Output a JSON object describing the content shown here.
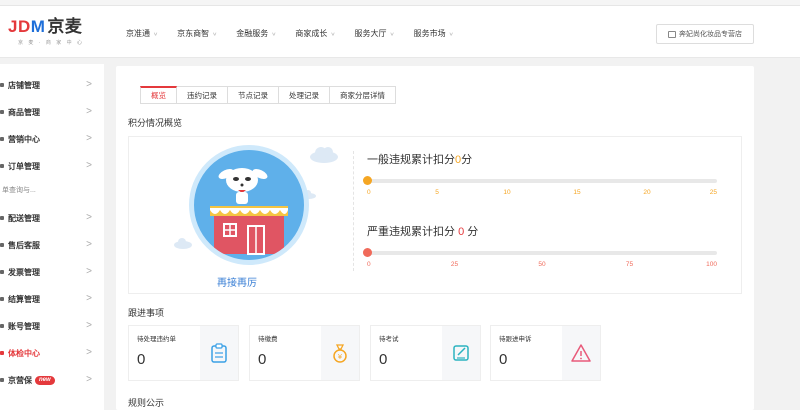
{
  "header": {
    "logo_text": "JDM",
    "logo_cn": "京麦",
    "logo_sub": "京 麦 · 商 家 中 心",
    "nav": [
      "京准通",
      "京东商智",
      "金融服务",
      "商家成长",
      "服务大厅",
      "服务市场"
    ],
    "store_button": "奔妃尚化妆品专营店"
  },
  "sidebar": {
    "items": [
      {
        "label": "店铺管理"
      },
      {
        "label": "商品管理"
      },
      {
        "label": "营销中心"
      },
      {
        "label": "订单管理"
      },
      {
        "label": "配送管理"
      },
      {
        "label": "售后客服"
      },
      {
        "label": "发票管理"
      },
      {
        "label": "结算管理"
      },
      {
        "label": "账号管理"
      },
      {
        "label": "体检中心"
      },
      {
        "label": "京营保"
      }
    ],
    "sub_text": "单查询与...",
    "new_badge": "new"
  },
  "main": {
    "tabs": [
      "概览",
      "违约记录",
      "节点记录",
      "处理记录",
      "商家分层详情"
    ],
    "active_tab": 0,
    "section_score": "积分情况概览",
    "avatar_label": "再接再厉",
    "general": {
      "title": "一般违规累计扣分",
      "value": "0",
      "unit": "分",
      "ticks": [
        "0",
        "5",
        "10",
        "15",
        "20",
        "25"
      ]
    },
    "serious": {
      "title": "严重违规累计扣分",
      "value": "0",
      "unit": "分",
      "ticks": [
        "0",
        "25",
        "50",
        "75",
        "100"
      ]
    },
    "section_follow": "跟进事项",
    "follow_cards": [
      {
        "label": "待处理违约单",
        "value": "0",
        "icon": "clipboard-icon"
      },
      {
        "label": "待缴费",
        "value": "0",
        "icon": "money-bag-icon"
      },
      {
        "label": "待考试",
        "value": "0",
        "icon": "edit-icon"
      },
      {
        "label": "待跟进申诉",
        "value": "0",
        "icon": "warning-icon"
      }
    ],
    "section_rules": "规则公示"
  },
  "colors": {
    "brand_red": "#e4393c",
    "orange": "#f5a623",
    "blue": "#3a7fd5"
  }
}
